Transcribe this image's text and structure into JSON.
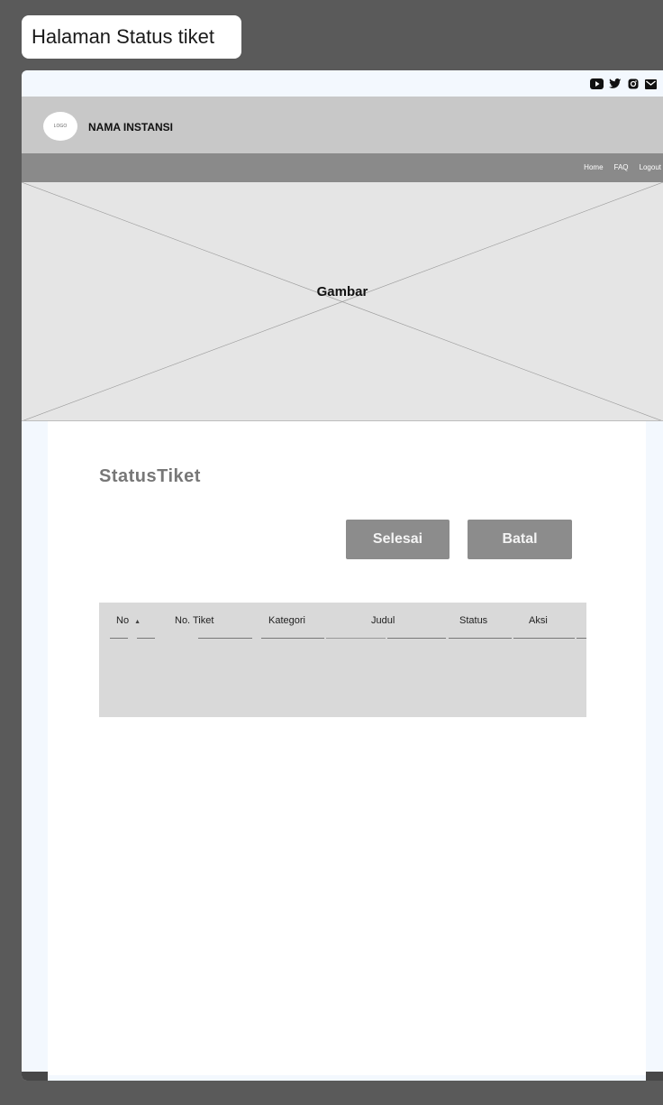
{
  "frame_label": "Halaman Status tiket",
  "social": {
    "icons": [
      "youtube-icon",
      "twitter-icon",
      "instagram-icon",
      "mail-icon"
    ]
  },
  "brand": {
    "logo_text": "LOGO",
    "org_name": "NAMA INSTANSI"
  },
  "nav": {
    "items": [
      "Home",
      "FAQ",
      "Logout"
    ]
  },
  "hero": {
    "label": "Gambar"
  },
  "main": {
    "title": "StatusTiket",
    "buttons": {
      "selesai": "Selesai",
      "batal": "Batal"
    },
    "table": {
      "headers": [
        "No",
        "No. Tiket",
        "Kategori",
        "Judul",
        "Status",
        "Aksi"
      ]
    }
  },
  "colors": {
    "background": "#5a5a5a",
    "brand_bar": "#c8c8c8",
    "nav_bar": "#8a8a8a",
    "button": "#8c8c8c",
    "table": "#d9d9d9"
  }
}
